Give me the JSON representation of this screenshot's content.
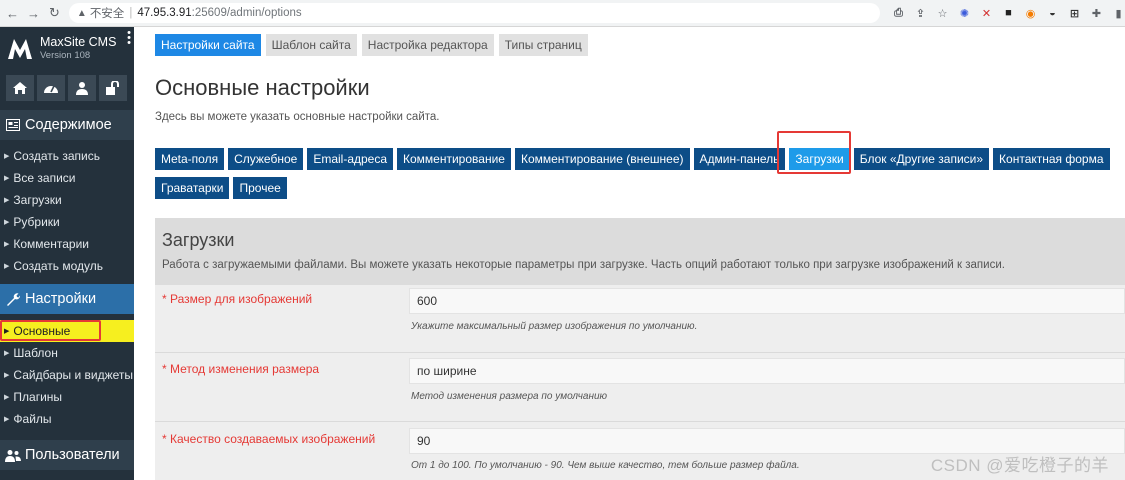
{
  "browser": {
    "security_label": "不安全",
    "url_host": "47.95.3.91",
    "url_path": ":25609/admin/options"
  },
  "sidebar": {
    "brand_name": "MaxSite CMS",
    "brand_version": "Version 108",
    "sections": {
      "content": "Содержимое",
      "settings": "Настройки",
      "users": "Пользователи"
    },
    "content_items": [
      {
        "label": "Создать запись"
      },
      {
        "label": "Все записи"
      },
      {
        "label": "Загрузки"
      },
      {
        "label": "Рубрики"
      },
      {
        "label": "Комментарии"
      },
      {
        "label": "Создать модуль"
      }
    ],
    "settings_items": [
      {
        "label": "Основные"
      },
      {
        "label": "Шаблон"
      },
      {
        "label": "Сайдбары и виджеты"
      },
      {
        "label": "Плагины"
      },
      {
        "label": "Файлы"
      }
    ]
  },
  "top_tabs": [
    {
      "label": "Настройки сайта"
    },
    {
      "label": "Шаблон сайта"
    },
    {
      "label": "Настройка редактора"
    },
    {
      "label": "Типы страниц"
    }
  ],
  "page": {
    "title": "Основные настройки",
    "description": "Здесь вы можете указать основные настройки сайта."
  },
  "sub_tabs": [
    {
      "label": "Meta-поля"
    },
    {
      "label": "Служебное"
    },
    {
      "label": "Email-адреса"
    },
    {
      "label": "Комментирование"
    },
    {
      "label": "Комментирование (внешнее)"
    },
    {
      "label": "Админ-панель"
    },
    {
      "label": "Загрузки"
    },
    {
      "label": "Блок «Другие записи»"
    },
    {
      "label": "Контактная форма"
    },
    {
      "label": "Граватарки"
    },
    {
      "label": "Прочее"
    }
  ],
  "panel": {
    "title": "Загрузки",
    "description": "Работа с загружаемыми файлами. Вы можете указать некоторые параметры при загрузке. Часть опций работают только при загрузке изображений к записи.",
    "fields": [
      {
        "label": "* Размер для изображений",
        "value": "600",
        "hint": "Укажите максимальный размер изображения по умолчанию."
      },
      {
        "label": "* Метод изменения размера",
        "value": "по ширине",
        "hint": "Метод изменения размера по умолчанию"
      },
      {
        "label": "* Качество создаваемых изображений",
        "value": "90",
        "hint": "От 1 до 100. По умолчанию - 90. Чем выше качество, тем больше размер файла."
      }
    ]
  },
  "watermark": "CSDN @爱吃橙子的羊",
  "colors": {
    "sidebar_bg": "#24313c",
    "settings_section_bg": "#2c6fa8",
    "active_menu_bg": "#f6ef1f",
    "subtab_bg": "#0d4d87",
    "active_tab_bg": "#1e88e5",
    "highlight_outline": "#e53935"
  }
}
